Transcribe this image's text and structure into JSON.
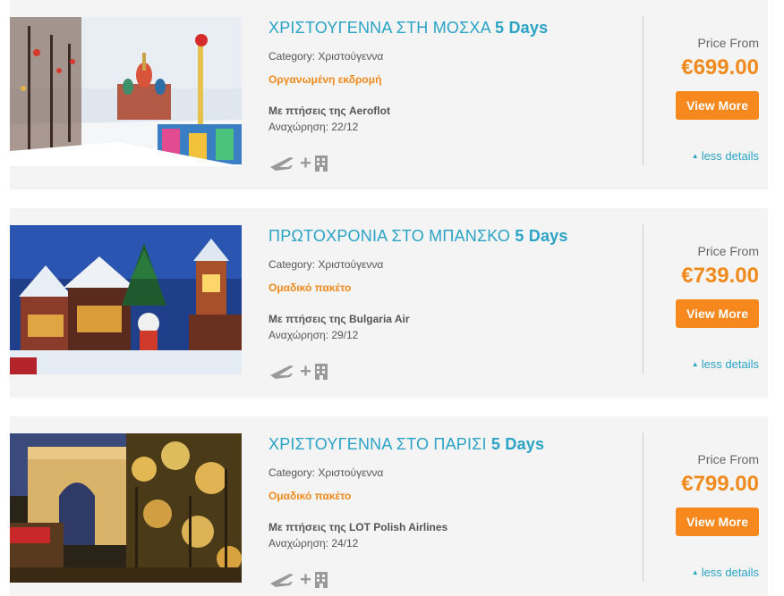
{
  "offers": [
    {
      "title": "ΧΡΙΣΤΟΥΓΕΝΝΑ ΣΤΗ ΜΟΣΧΑ",
      "duration": "5 Days",
      "category": "Category: Χριστούγεννα",
      "type": "Οργανωμένη εκδρομή",
      "flights": "Με πτήσεις της Aeroflot",
      "departure": "Αναχώρηση: 22/12",
      "price_label": "Price From",
      "price": "€699.00",
      "button": "View More",
      "less": "less details",
      "image_icon": "moscow-red-square-image"
    },
    {
      "title": "ΠΡΩΤΟΧΡΟΝΙΑ ΣΤΟ ΜΠΑΝΣΚΟ",
      "duration": "5 Days",
      "category": "Category: Χριστούγεννα",
      "type": "Ομαδικό πακέτο",
      "flights": "Με πτήσεις της Bulgaria Air",
      "departure": "Αναχώρηση: 29/12",
      "price_label": "Price From",
      "price": "€739.00",
      "button": "View More",
      "less": "less details",
      "image_icon": "bansko-christmas-market-image"
    },
    {
      "title": "ΧΡΙΣΤΟΥΓΕΝΝΑ ΣΤΟ ΠΑΡΙΣΙ",
      "duration": "5 Days",
      "category": "Category: Χριστούγεννα",
      "type": "Ομαδικό πακέτο",
      "flights": "Με πτήσεις της LOT Polish Airlines",
      "departure": "Αναχώρηση: 24/12",
      "price_label": "Price From",
      "price": "€799.00",
      "button": "View More",
      "less": "less details",
      "image_icon": "paris-arc-de-triomphe-image"
    }
  ],
  "icons": {
    "flight": "plane-icon",
    "plus": "plus-icon",
    "hotel": "hotel-icon"
  },
  "colors": {
    "accent": "#2aa3c6",
    "orange": "#f08a1c",
    "button": "#f7881e",
    "card_bg": "#f4f4f4"
  }
}
